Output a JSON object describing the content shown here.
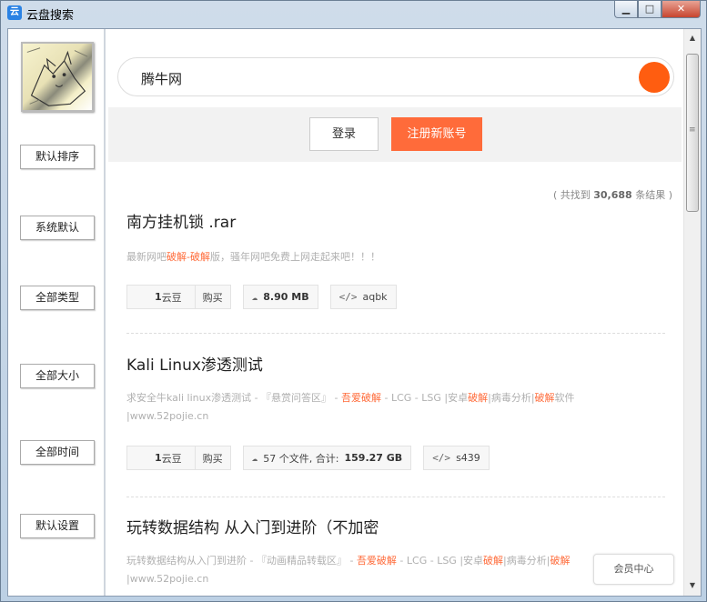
{
  "window": {
    "title": "云盘搜索",
    "app_icon": "cloud-icon",
    "min": "▁",
    "max": "□",
    "close": "✕"
  },
  "sidebar": {
    "buttons": [
      "默认排序",
      "系统默认",
      "全部类型",
      "全部大小",
      "全部时间",
      "默认设置"
    ]
  },
  "search": {
    "query": "腾牛网"
  },
  "auth": {
    "login": "登录",
    "register": "注册新账号"
  },
  "results_count": {
    "prefix": "( 共找到 ",
    "count": "30,688",
    "suffix": " 条结果 )"
  },
  "results": [
    {
      "title": "南方挂机锁 .rar",
      "desc_parts": [
        "最新网吧",
        "破解",
        "-",
        "破解",
        "版，骚年网吧免费上网走起来吧！！！"
      ],
      "price": "1",
      "price_unit": " 云豆",
      "buy": "购买",
      "size": "8.90 MB",
      "code": "aqbk"
    },
    {
      "title": "Kali Linux渗透测试",
      "desc_parts": [
        "求安全牛kali linux渗透测试 - 『悬赏问答区』 - ",
        "吾爱破解",
        " - LCG - LSG |安卓",
        "破解",
        "|病毒分析|",
        "破解",
        "软件"
      ],
      "desc_line2": "|www.52pojie.cn",
      "price": "1",
      "price_unit": " 云豆",
      "buy": "购买",
      "files_prefix": "57 个文件, 合计: ",
      "size": "159.27 GB",
      "code": "s439"
    },
    {
      "title": "玩转数据结构 从入门到进阶（不加密",
      "desc_parts": [
        "玩转数据结构从入门到进阶 - 『动画精品转载区』 - ",
        "吾爱破解",
        " - LCG - LSG |安卓",
        "破解",
        "|病毒分析|",
        "破解"
      ],
      "desc_line2": "|www.52pojie.cn"
    }
  ],
  "vip": "会员中心",
  "colors": {
    "accent": "#ff6b3a",
    "search_button": "#ff5d10"
  }
}
